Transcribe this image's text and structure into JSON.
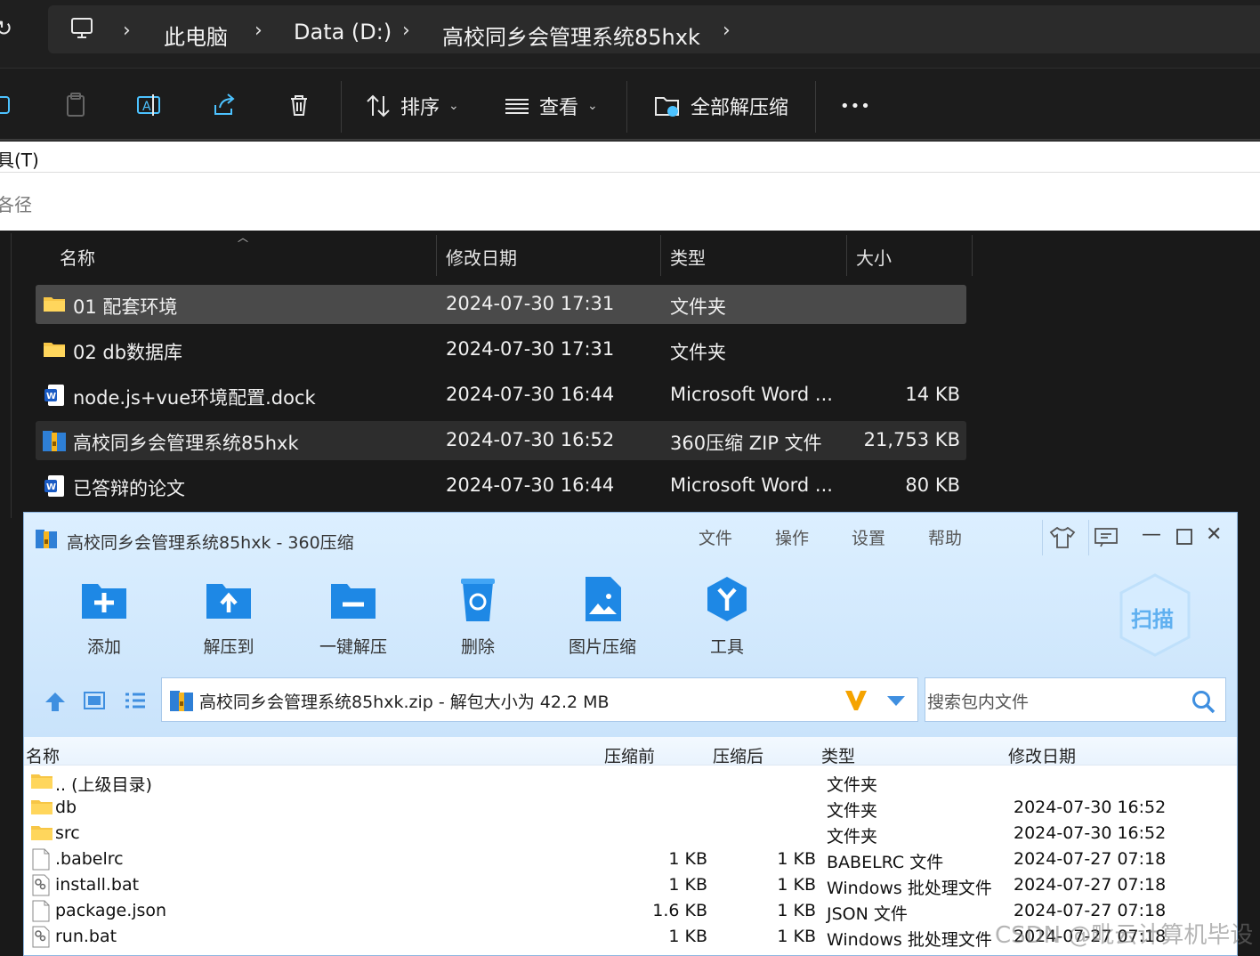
{
  "explorer": {
    "breadcrumbs": [
      "此电脑",
      "Data (D:)",
      "高校同乡会管理系统85hxk"
    ],
    "toolbar": {
      "sort": "排序",
      "view": "查看",
      "extract_all": "全部解压缩",
      "more": "•••"
    },
    "menu_fragment": "具(T)",
    "path_fragment": "各径",
    "columns": {
      "name": "名称",
      "modified": "修改日期",
      "type": "类型",
      "size": "大小"
    },
    "files": [
      {
        "name": "01 配套环境",
        "modified": "2024-07-30 17:31",
        "type": "文件夹",
        "size": "",
        "icon": "folder-icon"
      },
      {
        "name": "02 db数据库",
        "modified": "2024-07-30 17:31",
        "type": "文件夹",
        "size": "",
        "icon": "folder-icon"
      },
      {
        "name": "node.js+vue环境配置.dock",
        "modified": "2024-07-30 16:44",
        "type": "Microsoft Word ...",
        "size": "14 KB",
        "icon": "word-doc-icon"
      },
      {
        "name": "高校同乡会管理系统85hxk",
        "modified": "2024-07-30 16:52",
        "type": "360压缩 ZIP 文件",
        "size": "21,753 KB",
        "icon": "zip-archive-icon"
      },
      {
        "name": "已答辩的论文",
        "modified": "2024-07-30 16:44",
        "type": "Microsoft Word ...",
        "size": "80 KB",
        "icon": "word-doc-icon"
      }
    ]
  },
  "zip": {
    "title": "高校同乡会管理系统85hxk - 360压缩",
    "menu": [
      "文件",
      "操作",
      "设置",
      "帮助"
    ],
    "actions": [
      "添加",
      "解压到",
      "一键解压",
      "删除",
      "图片压缩",
      "工具"
    ],
    "scan_label": "扫描",
    "path_text": "高校同乡会管理系统85hxk.zip - 解包大小为 42.2 MB",
    "search_placeholder": "搜索包内文件",
    "columns": {
      "name": "名称",
      "before": "压缩前",
      "after": "压缩后",
      "type": "类型",
      "modified": "修改日期"
    },
    "entries": [
      {
        "name": ".. (上级目录)",
        "before": "",
        "after": "",
        "type": "文件夹",
        "modified": "",
        "icon": "folder-icon"
      },
      {
        "name": "db",
        "before": "",
        "after": "",
        "type": "文件夹",
        "modified": "2024-07-30 16:52",
        "icon": "folder-icon"
      },
      {
        "name": "src",
        "before": "",
        "after": "",
        "type": "文件夹",
        "modified": "2024-07-30 16:52",
        "icon": "folder-icon"
      },
      {
        "name": ".babelrc",
        "before": "1 KB",
        "after": "1 KB",
        "type": "BABELRC 文件",
        "modified": "2024-07-27 07:18",
        "icon": "file-icon"
      },
      {
        "name": "install.bat",
        "before": "1 KB",
        "after": "1 KB",
        "type": "Windows 批处理文件",
        "modified": "2024-07-27 07:18",
        "icon": "bat-file-icon"
      },
      {
        "name": "package.json",
        "before": "1.6 KB",
        "after": "1 KB",
        "type": "JSON 文件",
        "modified": "2024-07-27 07:18",
        "icon": "file-icon"
      },
      {
        "name": "run.bat",
        "before": "1 KB",
        "after": "1 KB",
        "type": "Windows 批处理文件",
        "modified": "2024-07-27 07:18",
        "icon": "bat-file-icon"
      }
    ]
  },
  "watermark": "CSDN @毗云计算机毕设"
}
